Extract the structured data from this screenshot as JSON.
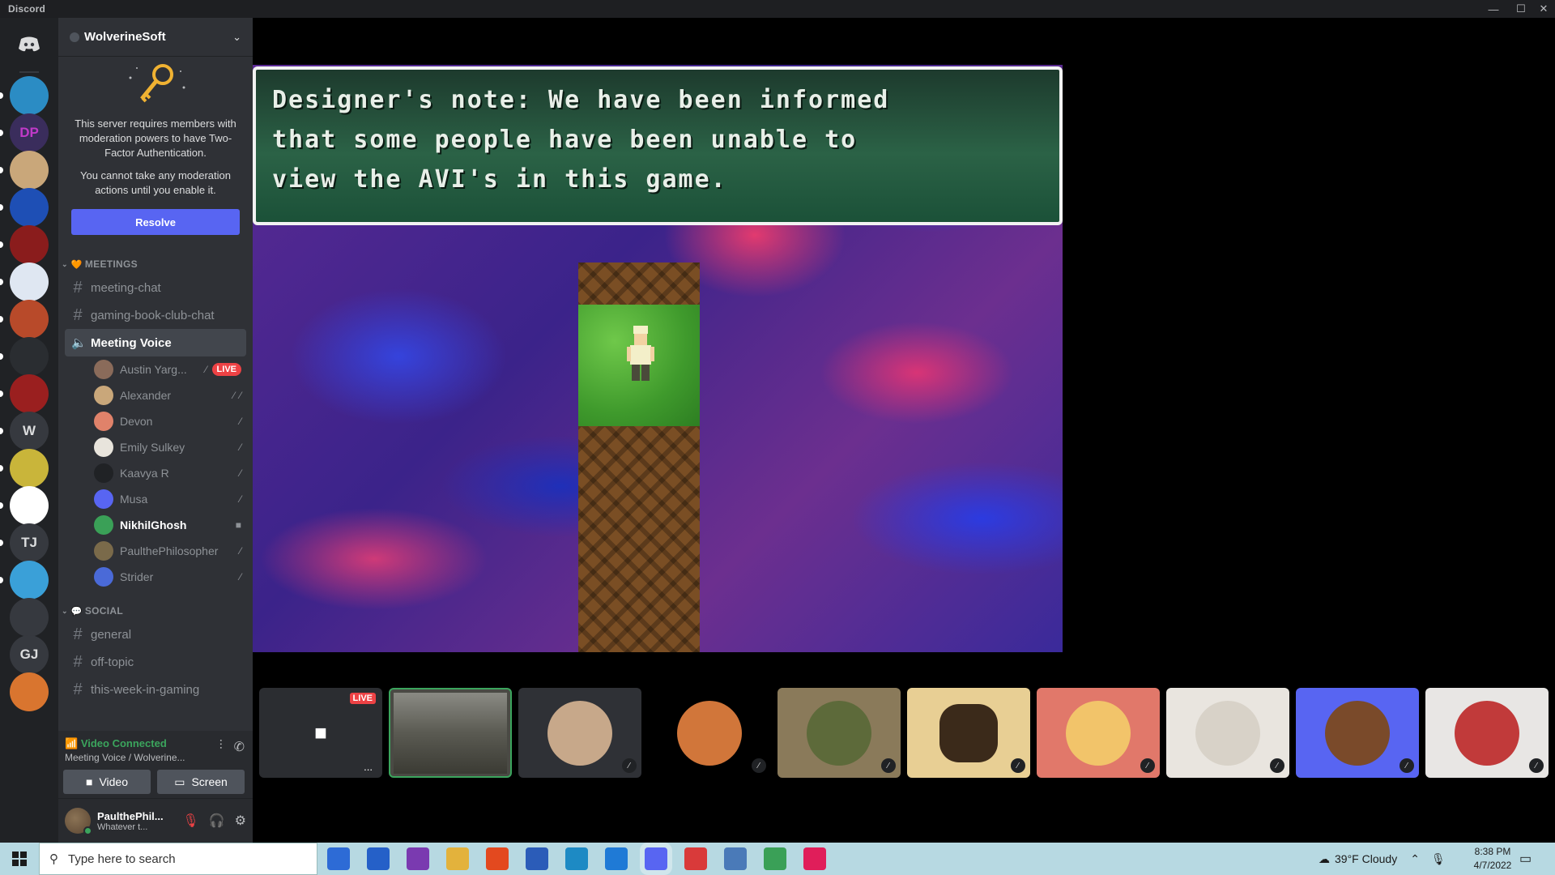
{
  "window": {
    "title": "Discord",
    "controls": [
      "—",
      "☐",
      "✕"
    ]
  },
  "servers": [
    {
      "name": "Home",
      "initials": "",
      "color": "#36393f"
    },
    {
      "name": "server-2",
      "initials": "",
      "color": "#2b8cc4"
    },
    {
      "name": "server-3",
      "initials": "DP",
      "color": "#3a2d5c"
    },
    {
      "name": "server-4",
      "initials": "",
      "color": "#c9a77a"
    },
    {
      "name": "server-5",
      "initials": "",
      "color": "#1e4fb5"
    },
    {
      "name": "server-6",
      "initials": "",
      "color": "#8a1c1c"
    },
    {
      "name": "server-7",
      "initials": "",
      "color": "#dfe7f2"
    },
    {
      "name": "server-8",
      "initials": "",
      "color": "#b84a2a"
    },
    {
      "name": "server-9",
      "initials": "",
      "color": "#2a2d31"
    },
    {
      "name": "server-10",
      "initials": "",
      "color": "#9a1f1f"
    },
    {
      "name": "W",
      "initials": "W",
      "color": "#36393f"
    },
    {
      "name": "server-12",
      "initials": "",
      "color": "#c9b53a"
    },
    {
      "name": "server-13",
      "initials": "",
      "color": "#ffffff"
    },
    {
      "name": "TJ",
      "initials": "TJ",
      "color": "#36393f"
    },
    {
      "name": "server-15",
      "initials": "",
      "color": "#3aa0d8"
    },
    {
      "name": "server-16",
      "initials": "",
      "color": "#36393f"
    },
    {
      "name": "GJ",
      "initials": "GJ",
      "color": "#36393f"
    },
    {
      "name": "server-18",
      "initials": "",
      "color": "#d9752f"
    }
  ],
  "guild": {
    "name": "WolverineSoft"
  },
  "twofa": {
    "message1": "This server requires members with moderation powers to have Two-Factor Authentication.",
    "message2": "You cannot take any moderation actions until you enable it.",
    "resolve_label": "Resolve"
  },
  "meetings": {
    "category": "MEETINGS",
    "emoji": "🧡",
    "channels": [
      "meeting-chat",
      "gaming-book-club-chat"
    ],
    "voice_channel": "Meeting Voice",
    "voice_users": [
      {
        "name": "Austin Yarg...",
        "color": "#8a6b5a",
        "live": "LIVE"
      },
      {
        "name": "Alexander",
        "color": "#c9a77a"
      },
      {
        "name": "Devon",
        "color": "#e0826a"
      },
      {
        "name": "Emily Sulkey",
        "color": "#e8e4dc"
      },
      {
        "name": "Kaavya R",
        "color": "#202225"
      },
      {
        "name": "Musa",
        "color": "#5865f2"
      },
      {
        "name": "NikhilGhosh",
        "color": "#3aa057"
      },
      {
        "name": "PaulthePhilosopher",
        "color": "#7a6a4a"
      },
      {
        "name": "Strider",
        "color": "#4a6ad8"
      }
    ]
  },
  "social": {
    "category": "SOCIAL",
    "emoji": "💬",
    "channels": [
      "general",
      "off-topic",
      "this-week-in-gaming"
    ]
  },
  "rtc": {
    "status": "Video Connected",
    "subtitle": "Meeting Voice / Wolverine...",
    "video_label": "Video",
    "screen_label": "Screen"
  },
  "user": {
    "name": "PaulthePhil...",
    "status": "Whatever t..."
  },
  "game": {
    "dialog_lines": [
      "Designer's note:  We have been informed",
      "that some people have been unable to",
      "view the AVI's in this game."
    ]
  },
  "tiles": [
    {
      "name": "stream-preview",
      "live": "LIVE",
      "bg": "#2b2d31",
      "more": "..."
    },
    {
      "name": "room-camera",
      "bg": "#4a4a44"
    },
    {
      "name": "photo-person",
      "bg": "#2f3136",
      "avatar": "#c7a88a"
    },
    {
      "name": "dragon-avatar",
      "bg": "#000000",
      "avatar": "#d1763a"
    },
    {
      "name": "landscape-avatar",
      "bg": "#8a7a5a",
      "avatar": "#5d6a3a"
    },
    {
      "name": "pencil-avatar",
      "bg": "#e8cf94",
      "avatar": "#3b2a1a"
    },
    {
      "name": "chicken-avatar",
      "bg": "#e1786a",
      "avatar": "#f2c46a"
    },
    {
      "name": "sketch-avatar",
      "bg": "#e9e5df",
      "avatar": "#d8d2c8"
    },
    {
      "name": "pixel-avatar",
      "bg": "#5865f2",
      "avatar": "#7a4a2a"
    },
    {
      "name": "anime-avatar",
      "bg": "#e8e6e4",
      "avatar": "#c13a3a"
    }
  ],
  "taskbar": {
    "search_placeholder": "Type here to search",
    "apps": [
      "store",
      "mail",
      "podcast",
      "files",
      "office",
      "word",
      "edge",
      "vscode",
      "discord",
      "media",
      "pen",
      "chrome",
      "slack"
    ],
    "weather": "39°F  Cloudy",
    "time": "8:38 PM",
    "date": "4/7/2022"
  }
}
